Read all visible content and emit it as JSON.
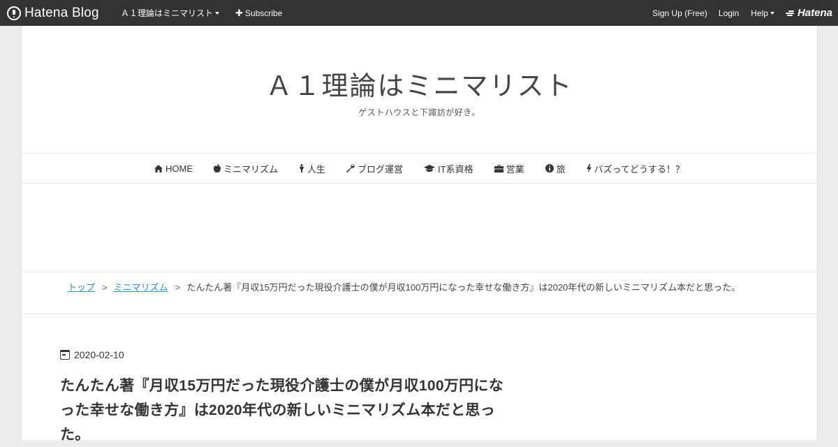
{
  "topbar": {
    "logo_text": "Hatena Blog",
    "blog_name": "Ａ１理論はミニマリスト",
    "subscribe": "Subscribe",
    "signup": "Sign Up (Free)",
    "login": "Login",
    "help": "Help",
    "brand": "Hatena"
  },
  "header": {
    "title": "Ａ１理論はミニマリスト",
    "description": "ゲストハウスと下諏訪が好き。"
  },
  "nav": {
    "items": [
      {
        "label": "HOME",
        "icon": "home-icon"
      },
      {
        "label": "ミニマリズム",
        "icon": "apple-icon"
      },
      {
        "label": "人生",
        "icon": "person-icon"
      },
      {
        "label": "ブログ運営",
        "icon": "wrench-icon"
      },
      {
        "label": "IT系資格",
        "icon": "graduation-cap-icon"
      },
      {
        "label": "営業",
        "icon": "briefcase-icon"
      },
      {
        "label": "旅",
        "icon": "info-icon"
      },
      {
        "label": "バズってどうする！？",
        "icon": "bolt-icon"
      }
    ]
  },
  "breadcrumb": {
    "items": [
      "トップ",
      "ミニマリズム"
    ],
    "separator": ">",
    "current": "たんたん著『月収15万円だった現役介護士の僕が月収100万円になった幸せな働き方』は2020年代の新しいミニマリズム本だと思った。"
  },
  "entry": {
    "date": "2020-02-10",
    "title": "たんたん著『月収15万円だった現役介護士の僕が月収100万円になった幸せな働き方』は2020年代の新しいミニマリズム本だと思った。"
  }
}
